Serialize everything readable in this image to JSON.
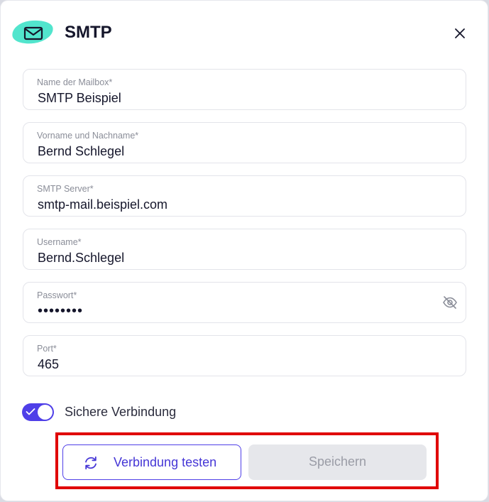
{
  "dialog": {
    "title": "SMTP",
    "icons": {
      "brand": "mail-icon",
      "close": "close-icon"
    }
  },
  "form": {
    "fields": [
      {
        "label": "Name der Mailbox*",
        "value": "SMTP Beispiel"
      },
      {
        "label": "Vorname und Nachname*",
        "value": "Bernd Schlegel"
      },
      {
        "label": "SMTP Server*",
        "value": "smtp-mail.beispiel.com"
      },
      {
        "label": "Username*",
        "value": "Bernd.Schlegel"
      },
      {
        "label": "Passwort*",
        "value": "••••••••",
        "icon": "eye-off-icon"
      },
      {
        "label": "Port*",
        "value": "465"
      }
    ],
    "secure_connection": {
      "label": "Sichere Verbindung",
      "enabled": true
    }
  },
  "actions": {
    "test_label": "Verbindung testen",
    "test_icon": "refresh-icon",
    "save_label": "Speichern",
    "save_disabled": true
  },
  "colors": {
    "accent": "#4f3fe8",
    "brand_blob": "#3fe2c8",
    "highlight": "#e00000"
  }
}
